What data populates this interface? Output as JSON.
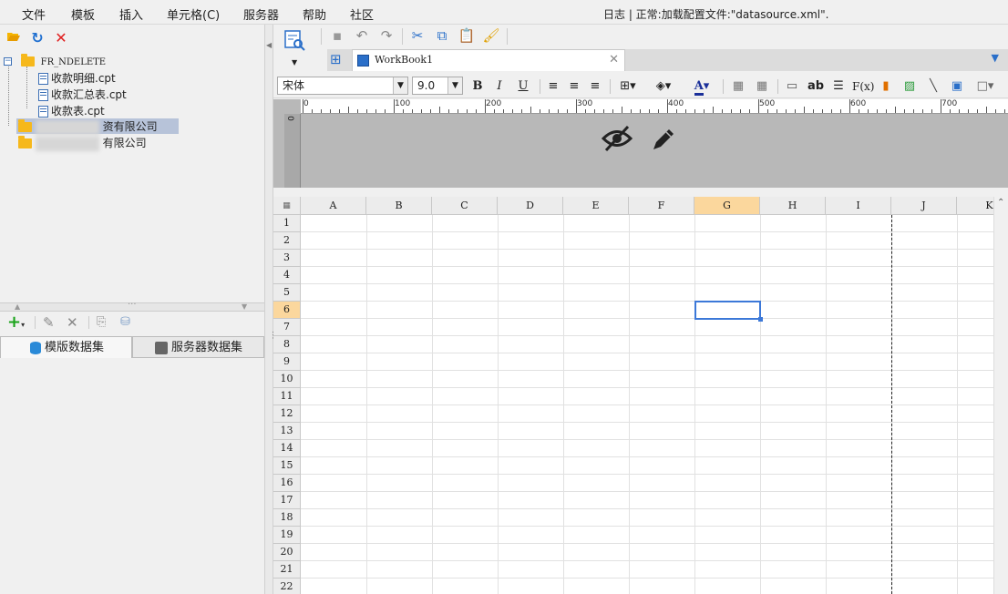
{
  "menu": [
    "文件",
    "模板",
    "插入",
    "单元格(C)",
    "服务器",
    "帮助",
    "社区"
  ],
  "status": "日志 | 正常:加载配置文件:\"datasource.xml\".",
  "tree": {
    "root": "FR_NDELETE",
    "files": [
      "收款明细.cpt",
      "收款汇总表.cpt",
      "收款表.cpt"
    ],
    "folders": [
      "资有限公司",
      "有限公司"
    ]
  },
  "dataset_tabs": [
    "模版数据集",
    "服务器数据集"
  ],
  "workbook_tab": "WorkBook1",
  "font": {
    "name": "宋体",
    "size": "9.0"
  },
  "format_buttons": {
    "bold": "B",
    "italic": "I",
    "underline": "U",
    "text": "ab",
    "formula": "F(x)",
    "font_color": "A"
  },
  "ruler_labels": [
    "0",
    "100",
    "200",
    "300",
    "400",
    "500",
    "600",
    "700"
  ],
  "vruler_label": "0",
  "columns": [
    "A",
    "B",
    "C",
    "D",
    "E",
    "F",
    "G",
    "H",
    "I",
    "J",
    "K"
  ],
  "rows": [
    "1",
    "2",
    "3",
    "4",
    "5",
    "6",
    "7",
    "8",
    "9",
    "10",
    "11",
    "12",
    "13",
    "14",
    "15",
    "16",
    "17",
    "18",
    "19",
    "20",
    "21",
    "22"
  ],
  "selected_cell": "G6",
  "icons": {
    "open": "folder-open-icon",
    "refresh": "refresh-icon",
    "delete": "delete-icon",
    "preview": "preview-icon",
    "save": "save-icon",
    "undo": "undo-icon",
    "redo": "redo-icon",
    "cut": "cut-icon",
    "copy": "copy-icon",
    "paste": "paste-icon",
    "format_painter": "brush-icon",
    "hidden": "eye-hidden-icon",
    "edit": "pencil-icon"
  },
  "colors": {
    "accent": "#3c78d8",
    "highlight_header": "#fbd79d",
    "selected_tree": "#b7c3d9"
  }
}
